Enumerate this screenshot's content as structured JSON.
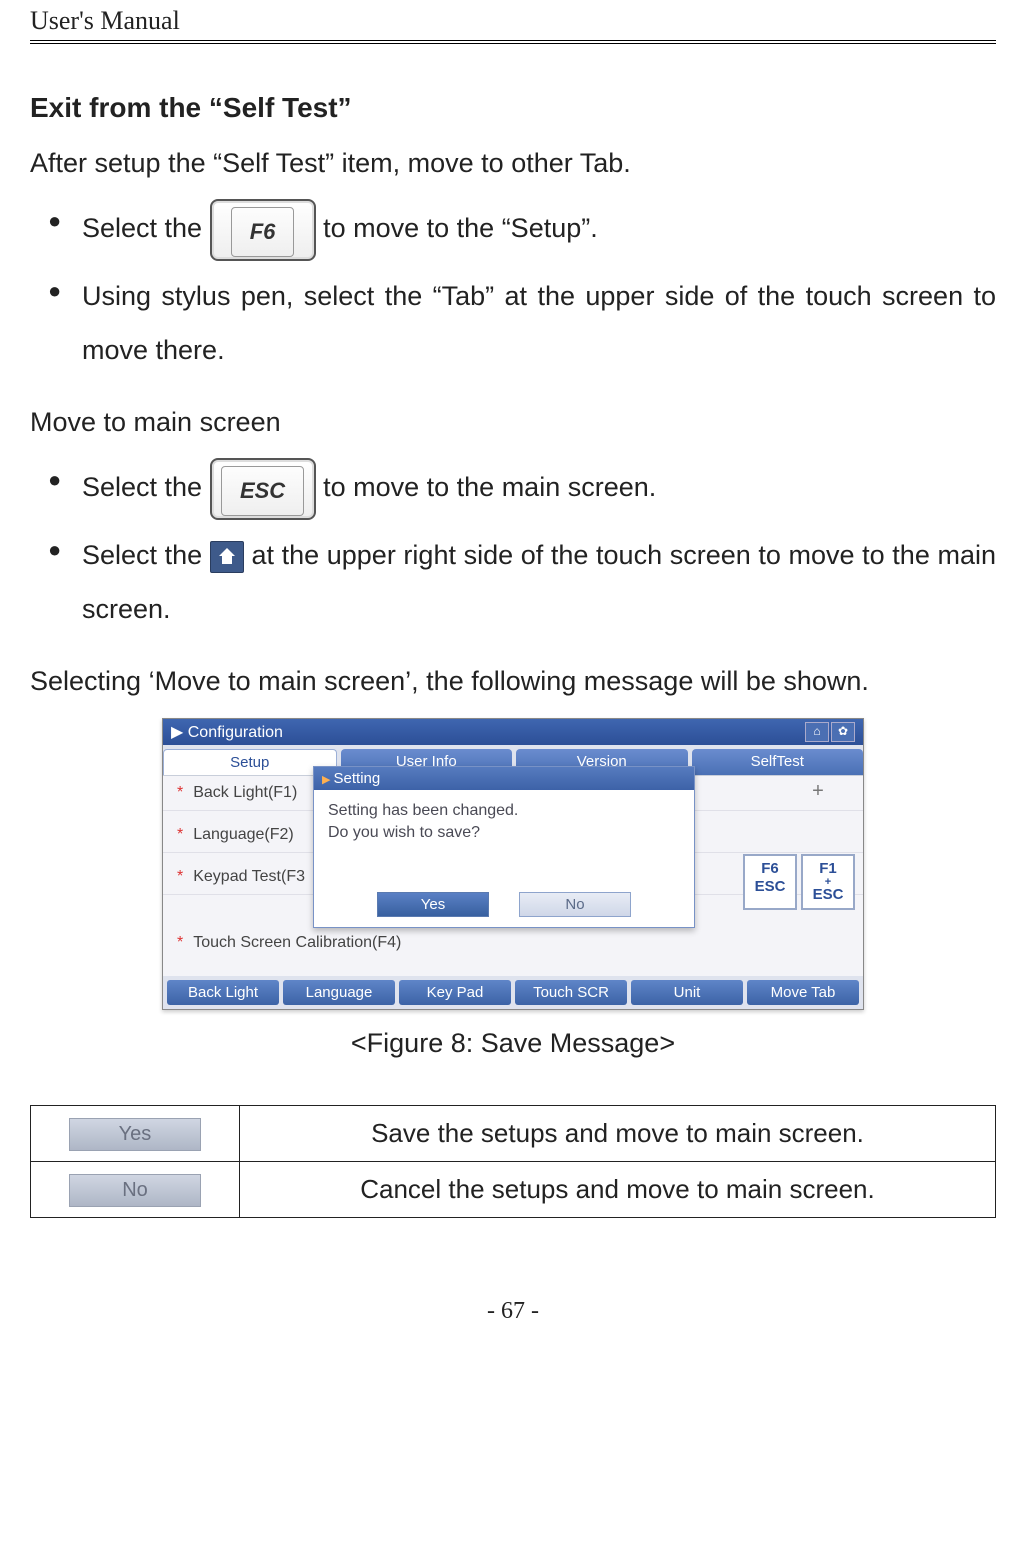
{
  "header": {
    "running": "User's Manual"
  },
  "section1": {
    "title": "Exit from the “Self Test”",
    "intro": "After setup the “Self Test” item, move to other Tab.",
    "b1_a": "Select the ",
    "b1_key": "F6",
    "b1_b": " to move to the “Setup”.",
    "b2": "Using stylus pen, select the “Tab” at the upper side of the touch screen to move there."
  },
  "section2": {
    "title": "Move to main screen",
    "b1_a": "Select the ",
    "b1_key": "ESC",
    "b1_b": " to move to the main screen.",
    "b2_a": "Select the ",
    "b2_b": " at the upper right side of the touch screen to move to the main screen."
  },
  "lead": "Selecting ‘Move to main screen’, the following message will be shown.",
  "shot": {
    "title": "Configuration",
    "tabs": [
      "Setup",
      "User Info",
      "Version",
      "SelfTest"
    ],
    "rows": [
      "Back Light(F1)",
      "Language(F2)",
      "Keypad Test(F3",
      "Touch Screen Calibration(F4)"
    ],
    "plus": "+",
    "side": {
      "k1a": "F6",
      "k1b": "ESC",
      "k2a": "F1",
      "k2b": "+",
      "k2c": "ESC"
    },
    "dialog": {
      "title": "Setting",
      "line1": "Setting has been changed.",
      "line2": "Do you wish to save?",
      "yes": "Yes",
      "no": "No"
    },
    "footer": [
      "Back Light",
      "Language",
      "Key Pad",
      "Touch SCR",
      "Unit",
      "Move Tab"
    ]
  },
  "caption": "<Figure 8: Save Message>",
  "table": {
    "yes_btn": "Yes",
    "yes_desc": "Save the setups and move to main screen.",
    "no_btn": "No",
    "no_desc": "Cancel the setups and move to main screen."
  },
  "page": "- 67 -"
}
